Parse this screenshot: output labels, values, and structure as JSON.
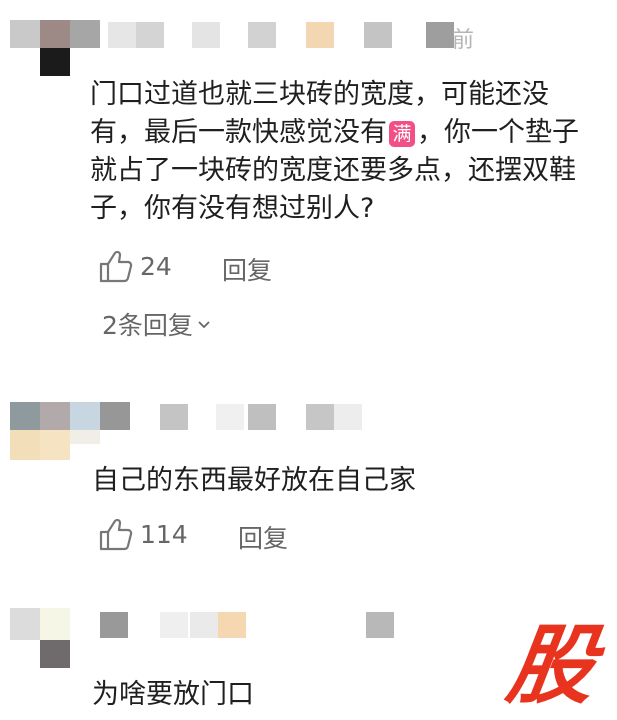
{
  "comments": [
    {
      "time_fragment": "前",
      "text_part1": "门口过道也就三块砖的宽度，可能还没有，最后一款快感觉没有",
      "emoji_char": "满",
      "text_part2": "，你一个垫子就占了一块砖的宽度还要多点，还摆双鞋子，你有没有想过别人?",
      "likes": "24",
      "reply_label": "回复",
      "replies_link": "2条回复"
    },
    {
      "text": "自己的东西最好放在自己家",
      "likes": "114",
      "reply_label": "回复"
    },
    {
      "text": "为啥要放门口"
    }
  ],
  "watermark": "股",
  "colors": {
    "accent_emoji": "#f24f86",
    "watermark": "#e8331e",
    "secondary_text": "#666666"
  },
  "icons": [
    "thumbs-up-icon",
    "chevron-down-icon"
  ]
}
